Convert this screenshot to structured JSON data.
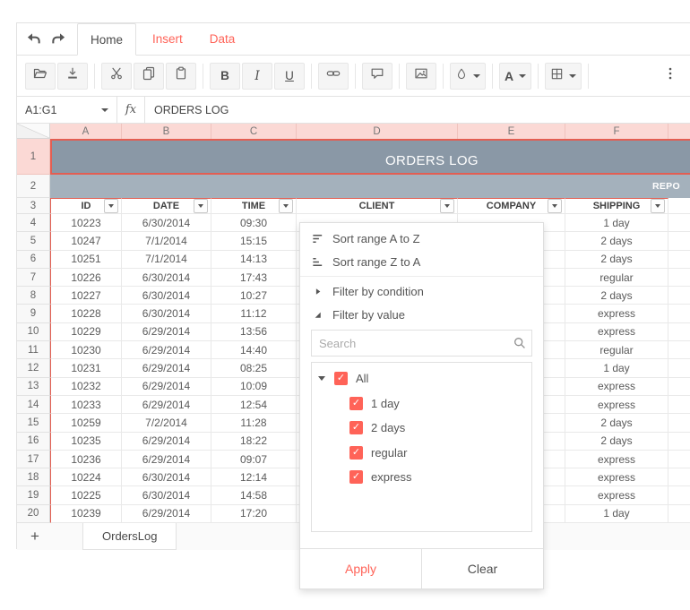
{
  "colors": {
    "accent": "#ff6358",
    "title_fill": "#8a98a6",
    "subtitle_fill": "#a4b1bc",
    "selection_tint": "#fbd9d5",
    "selection_border": "#e35e52"
  },
  "tabstrip": {
    "tabs": [
      {
        "label": "Home",
        "active": true
      },
      {
        "label": "Insert",
        "active": false
      },
      {
        "label": "Data",
        "active": false
      }
    ]
  },
  "toolbar": {
    "groups": [
      [
        {
          "icon": "open-folder-icon"
        },
        {
          "icon": "export-icon"
        }
      ],
      [
        {
          "icon": "cut-icon"
        },
        {
          "icon": "copy-icon"
        },
        {
          "icon": "paste-icon"
        }
      ],
      [
        {
          "icon": "bold-icon",
          "text": "B"
        },
        {
          "icon": "italic-icon",
          "text": "I"
        },
        {
          "icon": "underline-icon",
          "text": "U"
        }
      ],
      [
        {
          "icon": "link-icon"
        }
      ],
      [
        {
          "icon": "comment-icon"
        }
      ],
      [
        {
          "icon": "image-icon"
        }
      ],
      [
        {
          "icon": "fill-color-icon",
          "dropdown": true
        }
      ],
      [
        {
          "icon": "text-color-icon",
          "text": "A",
          "dropdown": true
        }
      ],
      [
        {
          "icon": "borders-icon",
          "dropdown": true
        }
      ]
    ],
    "more_icon": "more-vertical-icon"
  },
  "formula_bar": {
    "name_box": "A1:G1",
    "fx": "fx",
    "formula": "ORDERS LOG"
  },
  "grid": {
    "column_headers": [
      "A",
      "B",
      "C",
      "D",
      "E",
      "F"
    ],
    "row1": {
      "number": "1",
      "title": "ORDERS LOG"
    },
    "row2": {
      "number": "2",
      "text": "REPO"
    },
    "header_row": {
      "number": "3",
      "cells": [
        "ID",
        "DATE",
        "TIME",
        "CLIENT",
        "COMPANY",
        "SHIPPING"
      ]
    },
    "data_rows": [
      {
        "number": "4",
        "id": "10223",
        "date": "6/30/2014",
        "time": "09:30",
        "shipping": "1 day"
      },
      {
        "number": "5",
        "id": "10247",
        "date": "7/1/2014",
        "time": "15:15",
        "shipping": "2 days"
      },
      {
        "number": "6",
        "id": "10251",
        "date": "7/1/2014",
        "time": "14:13",
        "shipping": "2 days"
      },
      {
        "number": "7",
        "id": "10226",
        "date": "6/30/2014",
        "time": "17:43",
        "shipping": "regular"
      },
      {
        "number": "8",
        "id": "10227",
        "date": "6/30/2014",
        "time": "10:27",
        "shipping": "2 days"
      },
      {
        "number": "9",
        "id": "10228",
        "date": "6/30/2014",
        "time": "11:12",
        "shipping": "express"
      },
      {
        "number": "10",
        "id": "10229",
        "date": "6/29/2014",
        "time": "13:56",
        "shipping": "express"
      },
      {
        "number": "11",
        "id": "10230",
        "date": "6/29/2014",
        "time": "14:40",
        "shipping": "regular"
      },
      {
        "number": "12",
        "id": "10231",
        "date": "6/29/2014",
        "time": "08:25",
        "shipping": "1 day"
      },
      {
        "number": "13",
        "id": "10232",
        "date": "6/29/2014",
        "time": "10:09",
        "shipping": "express"
      },
      {
        "number": "14",
        "id": "10233",
        "date": "6/29/2014",
        "time": "12:54",
        "shipping": "express"
      },
      {
        "number": "15",
        "id": "10259",
        "date": "7/2/2014",
        "time": "11:28",
        "shipping": "2 days"
      },
      {
        "number": "16",
        "id": "10235",
        "date": "6/29/2014",
        "time": "18:22",
        "shipping": "2 days"
      },
      {
        "number": "17",
        "id": "10236",
        "date": "6/29/2014",
        "time": "09:07",
        "shipping": "express"
      },
      {
        "number": "18",
        "id": "10224",
        "date": "6/30/2014",
        "time": "12:14",
        "shipping": "express"
      },
      {
        "number": "19",
        "id": "10225",
        "date": "6/30/2014",
        "time": "14:58",
        "shipping": "express"
      },
      {
        "number": "20",
        "id": "10239",
        "date": "6/29/2014",
        "time": "17:20",
        "shipping": "1 day"
      }
    ]
  },
  "sheet_bar": {
    "add": "+",
    "tabs": [
      {
        "label": "OrdersLog",
        "active": true
      }
    ]
  },
  "filter_menu": {
    "items": [
      {
        "icon": "sort-asc-icon",
        "label": "Sort range A to Z"
      },
      {
        "icon": "sort-desc-icon",
        "label": "Sort range Z to A"
      },
      {
        "icon": "caret-right-icon",
        "label": "Filter by condition"
      },
      {
        "icon": "caret-expanded-icon",
        "label": "Filter by value"
      }
    ],
    "search": {
      "placeholder": "Search"
    },
    "values": [
      {
        "label": "All",
        "checked": true,
        "root": true
      },
      {
        "label": "1 day",
        "checked": true
      },
      {
        "label": "2 days",
        "checked": true
      },
      {
        "label": "regular",
        "checked": true
      },
      {
        "label": "express",
        "checked": true
      }
    ],
    "apply": "Apply",
    "clear": "Clear"
  }
}
